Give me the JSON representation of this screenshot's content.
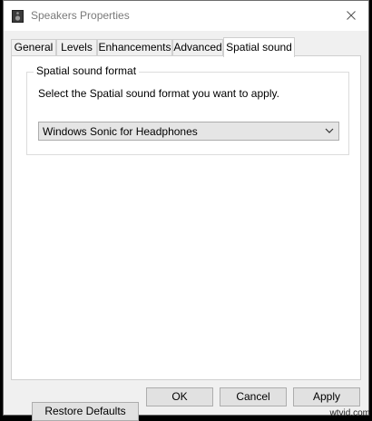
{
  "window": {
    "title": "Speakers Properties",
    "title_icon": "speaker-icon",
    "close_icon": "close-icon"
  },
  "tabs": [
    {
      "label": "General",
      "active": false
    },
    {
      "label": "Levels",
      "active": false
    },
    {
      "label": "Enhancements",
      "active": false
    },
    {
      "label": "Advanced",
      "active": false
    },
    {
      "label": "Spatial sound",
      "active": true
    }
  ],
  "spatial": {
    "group_title": "Spatial sound format",
    "instruction": "Select the Spatial sound format you want to apply.",
    "selected_format": "Windows Sonic for Headphones"
  },
  "buttons": {
    "restore": "Restore Defaults",
    "ok": "OK",
    "cancel": "Cancel",
    "apply": "Apply"
  },
  "watermark": "wtvid.com",
  "colors": {
    "window_bg": "#f0f0f0",
    "panel_bg": "#ffffff",
    "button_bg": "#e1e1e1",
    "button_border": "#adadad",
    "title_text": "#7a7a7a"
  }
}
